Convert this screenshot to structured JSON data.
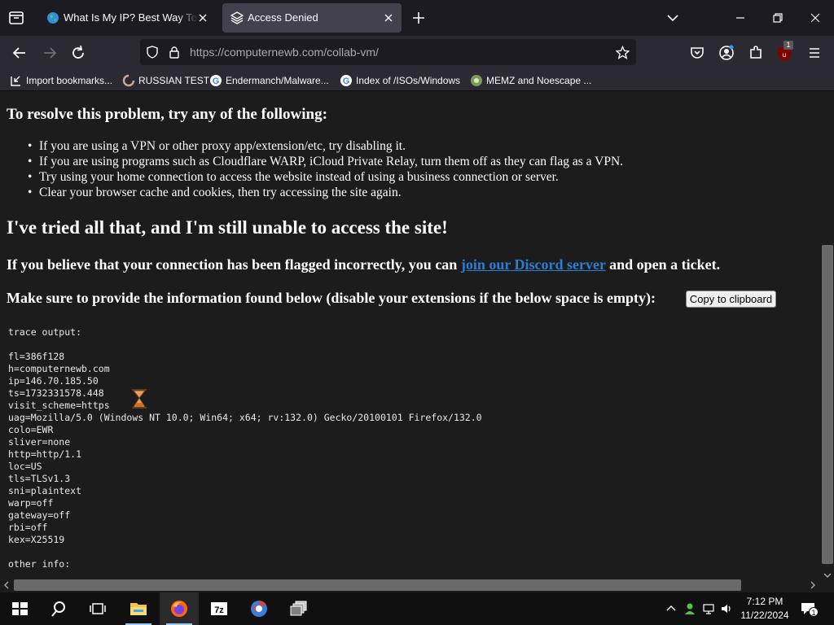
{
  "tabs": [
    {
      "title": "What Is My IP? Best Way To Check Your Public IP Address"
    },
    {
      "title": "Access Denied"
    }
  ],
  "url": {
    "host": "https://computernewb.com",
    "path": "/collab-vm/"
  },
  "bookmarks": [
    {
      "label": "Import bookmarks..."
    },
    {
      "label": "RUSSIAN TEST"
    },
    {
      "label": "Endermanch/Malware..."
    },
    {
      "label": "Index of /ISOs/Windows"
    },
    {
      "label": "MEMZ and Noescape ..."
    }
  ],
  "toolbar": {
    "extension_badge": "1"
  },
  "page": {
    "resolve_heading": "To resolve this problem, try any of the following:",
    "tips": [
      "If you are using a VPN or other proxy app/extension/etc, try disabling it.",
      "If you are using programs such as Cloudflare WARP, iCloud Private Relay, turn them off as they can flag as a VPN.",
      "Try using your home connection to access the website instead of using a business connection or server.",
      "Clear your browser cache and cookies, then try accessing the site again."
    ],
    "still_heading": "I've tried all that, and I'm still unable to access the site!",
    "flagged_pre": "If you believe that your connection has been flagged incorrectly, you can ",
    "discord_link": "join our Discord server",
    "flagged_post": " and open a ticket.",
    "provide_info": "Make sure to provide the information found below (disable your extensions if the below space is empty):",
    "copy_button": "Copy to clipboard",
    "trace_output": "trace output:\n\nfl=386f128\nh=computernewb.com\nip=146.70.185.50\nts=1732331578.448\nvisit_scheme=https\nuag=Mozilla/5.0 (Windows NT 10.0; Win64; x64; rv:132.0) Gecko/20100101 Firefox/132.0\ncolo=EWR\nsliver=none\nhttp=http/1.1\nloc=US\ntls=TLSv1.3\nsni=plaintext\nwarp=off\ngateway=off\nrbi=off\nkex=X25519\n\nother info:"
  },
  "taskbar": {
    "time": "7:12 PM",
    "date": "11/22/2024",
    "notification_count": "1"
  },
  "colors": {
    "link": "#2a7fd4",
    "content_bg": "#1c1c1c",
    "tab_active": "#42414d"
  }
}
